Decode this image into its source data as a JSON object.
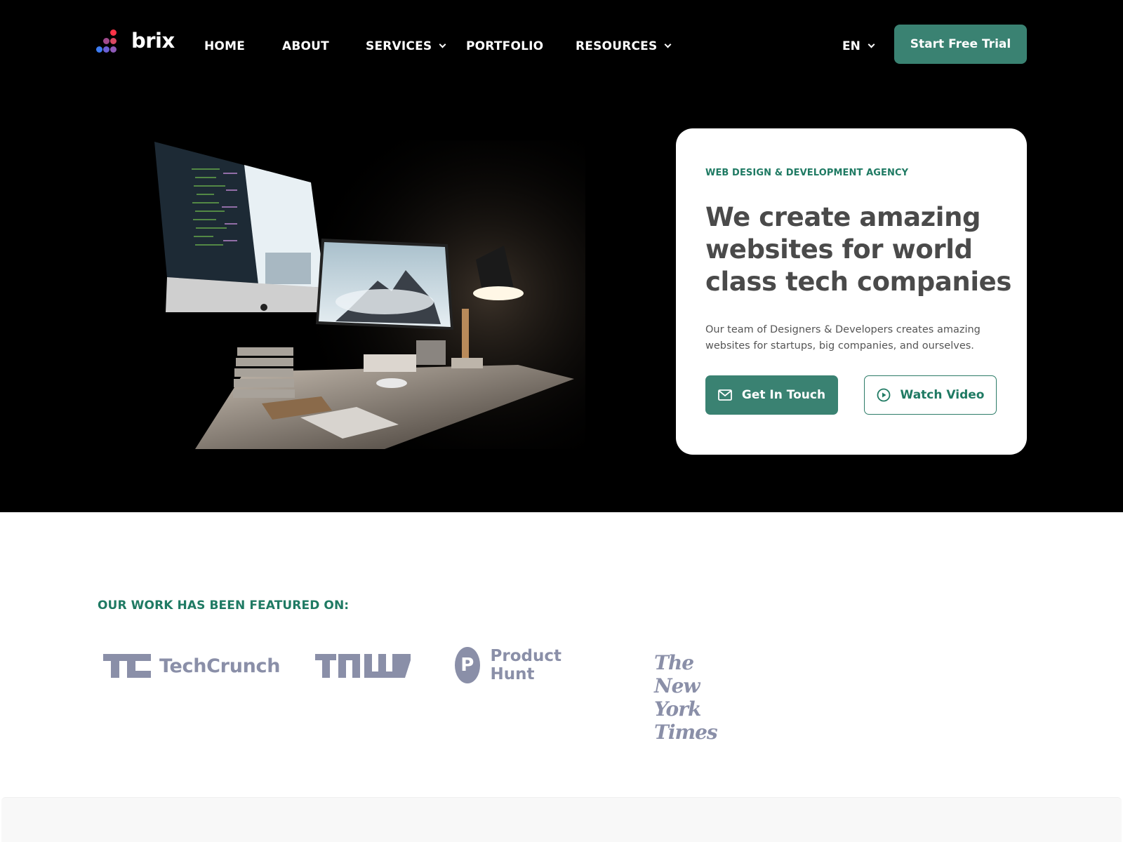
{
  "brand": {
    "name": "brix",
    "accent": "#3a8272",
    "accent_text": "#1f7a63",
    "logo_dot_colors": [
      "#ff3346",
      "#a04a8c",
      "#d94862",
      "#3d7cf2",
      "#6a5fd6",
      "#8e5ab8"
    ]
  },
  "nav": {
    "items": [
      {
        "label": "HOME",
        "has_dropdown": false
      },
      {
        "label": "ABOUT",
        "has_dropdown": false
      },
      {
        "label": "SERVICES",
        "has_dropdown": true
      },
      {
        "label": "PORTFOLIO",
        "has_dropdown": false
      },
      {
        "label": "RESOURCES",
        "has_dropdown": true
      }
    ],
    "language": "EN",
    "cta_label": "Start Free Trial"
  },
  "hero": {
    "image_alt": "Dark desk setup with iMac showing code, second monitor with misty mountain, desk lamp",
    "eyebrow": "WEB DESIGN & DEVELOPMENT AGENCY",
    "headline": "We create amazing websites for world class tech companies",
    "description": "Our team of Designers & Developers creates amazing websites for startups, big companies, and ourselves.",
    "primary_button": {
      "label": "Get In Touch",
      "icon": "mail-icon"
    },
    "secondary_button": {
      "label": "Watch Video",
      "icon": "play-circle-icon"
    }
  },
  "featured": {
    "title": "OUR WORK HAS BEEN FEATURED ON:",
    "logos": [
      {
        "name": "TechCrunch",
        "mark": "TC"
      },
      {
        "name": "TNW",
        "mark": "TNW"
      },
      {
        "name": "Product Hunt",
        "mark": "P"
      },
      {
        "name": "The New York Times",
        "mark": ""
      }
    ],
    "logo_color": "#8a8fa8"
  }
}
